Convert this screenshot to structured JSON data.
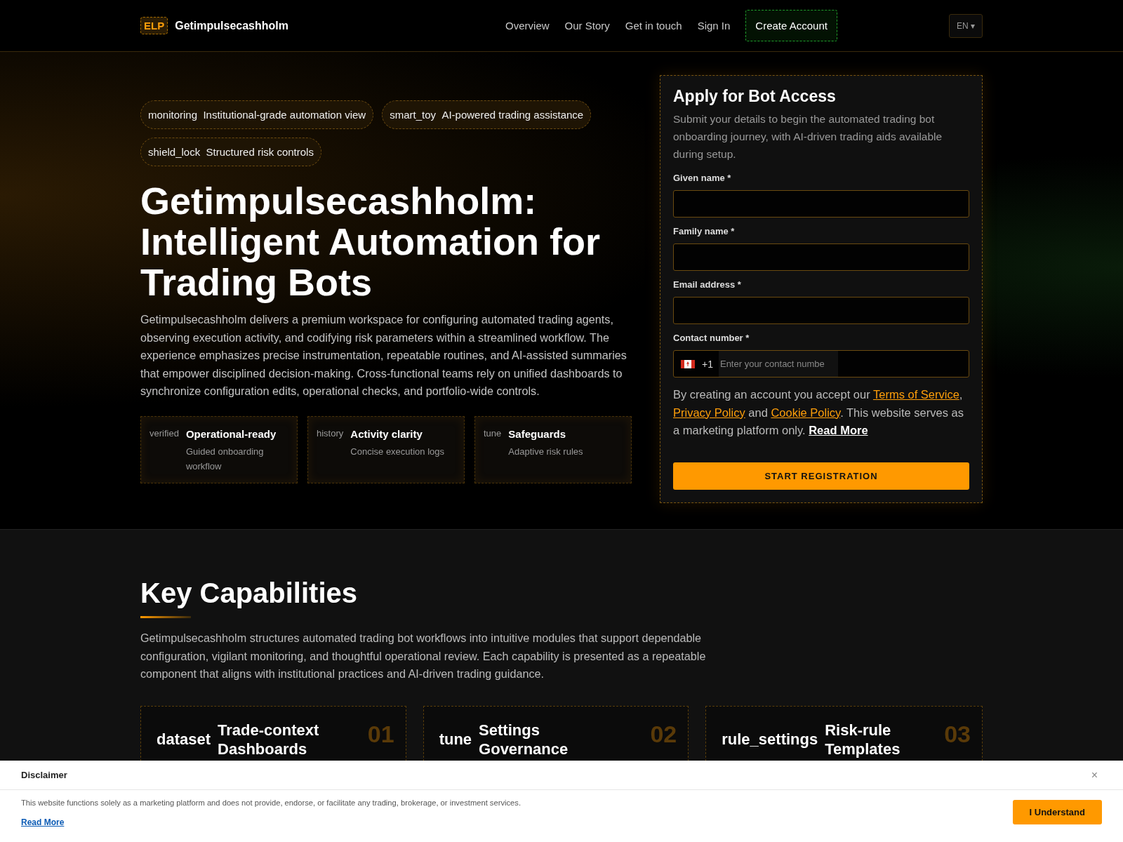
{
  "header": {
    "logo_mark": "ELP",
    "brand": "Getimpulsecashholm",
    "nav": [
      "Overview",
      "Our Story",
      "Get in touch",
      "Sign In"
    ],
    "cta": "Create Account",
    "language": "EN",
    "caret": "▾"
  },
  "hero": {
    "chips": [
      {
        "icon": "monitoring",
        "label": "Institutional-grade automation view"
      },
      {
        "icon": "smart_toy",
        "label": "AI-powered trading assistance"
      },
      {
        "icon": "shield_lock",
        "label": "Structured risk controls"
      }
    ],
    "title": "Getimpulsecashholm: Intelligent Automation for Trading Bots",
    "description": "Getimpulsecashholm delivers a premium workspace for configuring automated trading agents, observing execution activity, and codifying risk parameters within a streamlined workflow. The experience emphasizes precise instrumentation, repeatable routines, and AI-assisted summaries that empower disciplined decision-making. Cross-functional teams rely on unified dashboards to synchronize configuration edits, operational checks, and portfolio-wide controls.",
    "features": [
      {
        "icon": "verified",
        "title": "Operational-ready",
        "text": "Guided onboarding workflow"
      },
      {
        "icon": "history",
        "title": "Activity clarity",
        "text": "Concise execution logs"
      },
      {
        "icon": "tune",
        "title": "Safeguards",
        "text": "Adaptive risk rules"
      }
    ]
  },
  "form": {
    "title": "Apply for Bot Access",
    "subtitle": "Submit your details to begin the automated trading bot onboarding journey, with AI-driven trading aids available during setup.",
    "fields": [
      {
        "kind": "text",
        "label": "Given name *"
      },
      {
        "kind": "text",
        "label": "Family name *"
      },
      {
        "kind": "text",
        "label": "Email address *"
      },
      {
        "kind": "phone",
        "label": "Contact number *",
        "prefix": "+1",
        "placeholder": "Enter your contact numbe"
      }
    ],
    "consent": {
      "before": "By creating an account you accept our ",
      "terms": "Terms of Service",
      "comma": ",",
      "privacy": "Privacy Policy",
      "and": " and ",
      "cookie": "Cookie Policy",
      "after": ". This website serves as a marketing platform only. ",
      "read_more": "Read More"
    },
    "submit": "START REGISTRATION"
  },
  "capabilities": {
    "title": "Key Capabilities",
    "description": "Getimpulsecashholm structures automated trading bot workflows into intuitive modules that support dependable configuration, vigilant monitoring, and thoughtful operational review. Each capability is presented as a repeatable component that aligns with institutional practices and AI-driven trading guidance.",
    "cards": [
      {
        "icon": "dataset",
        "title": "Trade-context Dashboards",
        "number": "01"
      },
      {
        "icon": "tune",
        "title": "Settings Governance",
        "number": "02"
      },
      {
        "icon": "rule_settings",
        "title": "Risk-rule Templates",
        "number": "03"
      }
    ]
  },
  "disclaimer": {
    "title": "Disclaimer",
    "close": "×",
    "text": "This website functions solely as a marketing platform and does not provide, endorse, or facilitate any trading, brokerage, or investment services.",
    "link": "Read More",
    "button": "I Understand"
  }
}
